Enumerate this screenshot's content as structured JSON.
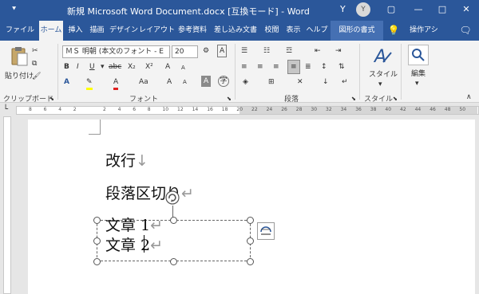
{
  "titlebar": {
    "qat_icon": "quick-access-dropdown-icon",
    "title": "新規 Microsoft Word Document.docx [互換モード]  -  Word",
    "user_initial": "Y",
    "avatar_initial": "Y",
    "restore_icon": "▢",
    "minimize_icon": "—",
    "maximize_icon": "□",
    "close_icon": "✕"
  },
  "tabs": {
    "file": "ファイル",
    "home": "ホーム",
    "insert": "挿入",
    "draw": "描画",
    "design": "デザイン",
    "layout": "レイアウト",
    "references": "参考資料",
    "mailings": "差し込み文書",
    "review": "校閲",
    "view": "表示",
    "help": "ヘルプ",
    "shape_format": "図形の書式",
    "tell_me": "操作アシ",
    "share_icon": "comment-icon"
  },
  "ribbon": {
    "paste_label": "貼り付け",
    "clipboard_label": "クリップボード",
    "font_name": "ＭＳ 明朝 (本文のフォント - E",
    "font_size": "20",
    "font_label": "フォント",
    "paragraph_label": "段落",
    "style_button": "スタイル",
    "style_group_label": "スタイル",
    "edit_button": "編集",
    "bold": "B",
    "italic": "I",
    "underline": "U",
    "strike": "abc",
    "subscript": "X₂",
    "superscript": "X²",
    "font_color": "A",
    "grow_font": "A",
    "shrink_font": "A",
    "change_case": "Aa",
    "clear_format": "A",
    "phonetic": "亜",
    "char_border": "A",
    "enclosed": "字",
    "shading_a": "A"
  },
  "ruler": {
    "ticks": [
      "8",
      "6",
      "4",
      "2",
      "",
      "2",
      "4",
      "6",
      "8",
      "10",
      "12",
      "14",
      "16",
      "18",
      "20",
      "22",
      "24",
      "26",
      "28",
      "30",
      "32",
      "34",
      "36",
      "38",
      "40",
      "42",
      "44",
      "46",
      "48",
      "50"
    ]
  },
  "document": {
    "line1": "改行",
    "line1_mark": "↓",
    "line2": "段落区切り",
    "line2_mark": "↵",
    "box_line1": "文章 1",
    "box_line1_mark": "↵",
    "box_line2": "文章 2",
    "box_line2_mark": "↵"
  },
  "colors": {
    "brand": "#2b579a",
    "ribbon": "#f3f3f3",
    "highlight": "#ffff00",
    "font_red": "#e02020"
  }
}
